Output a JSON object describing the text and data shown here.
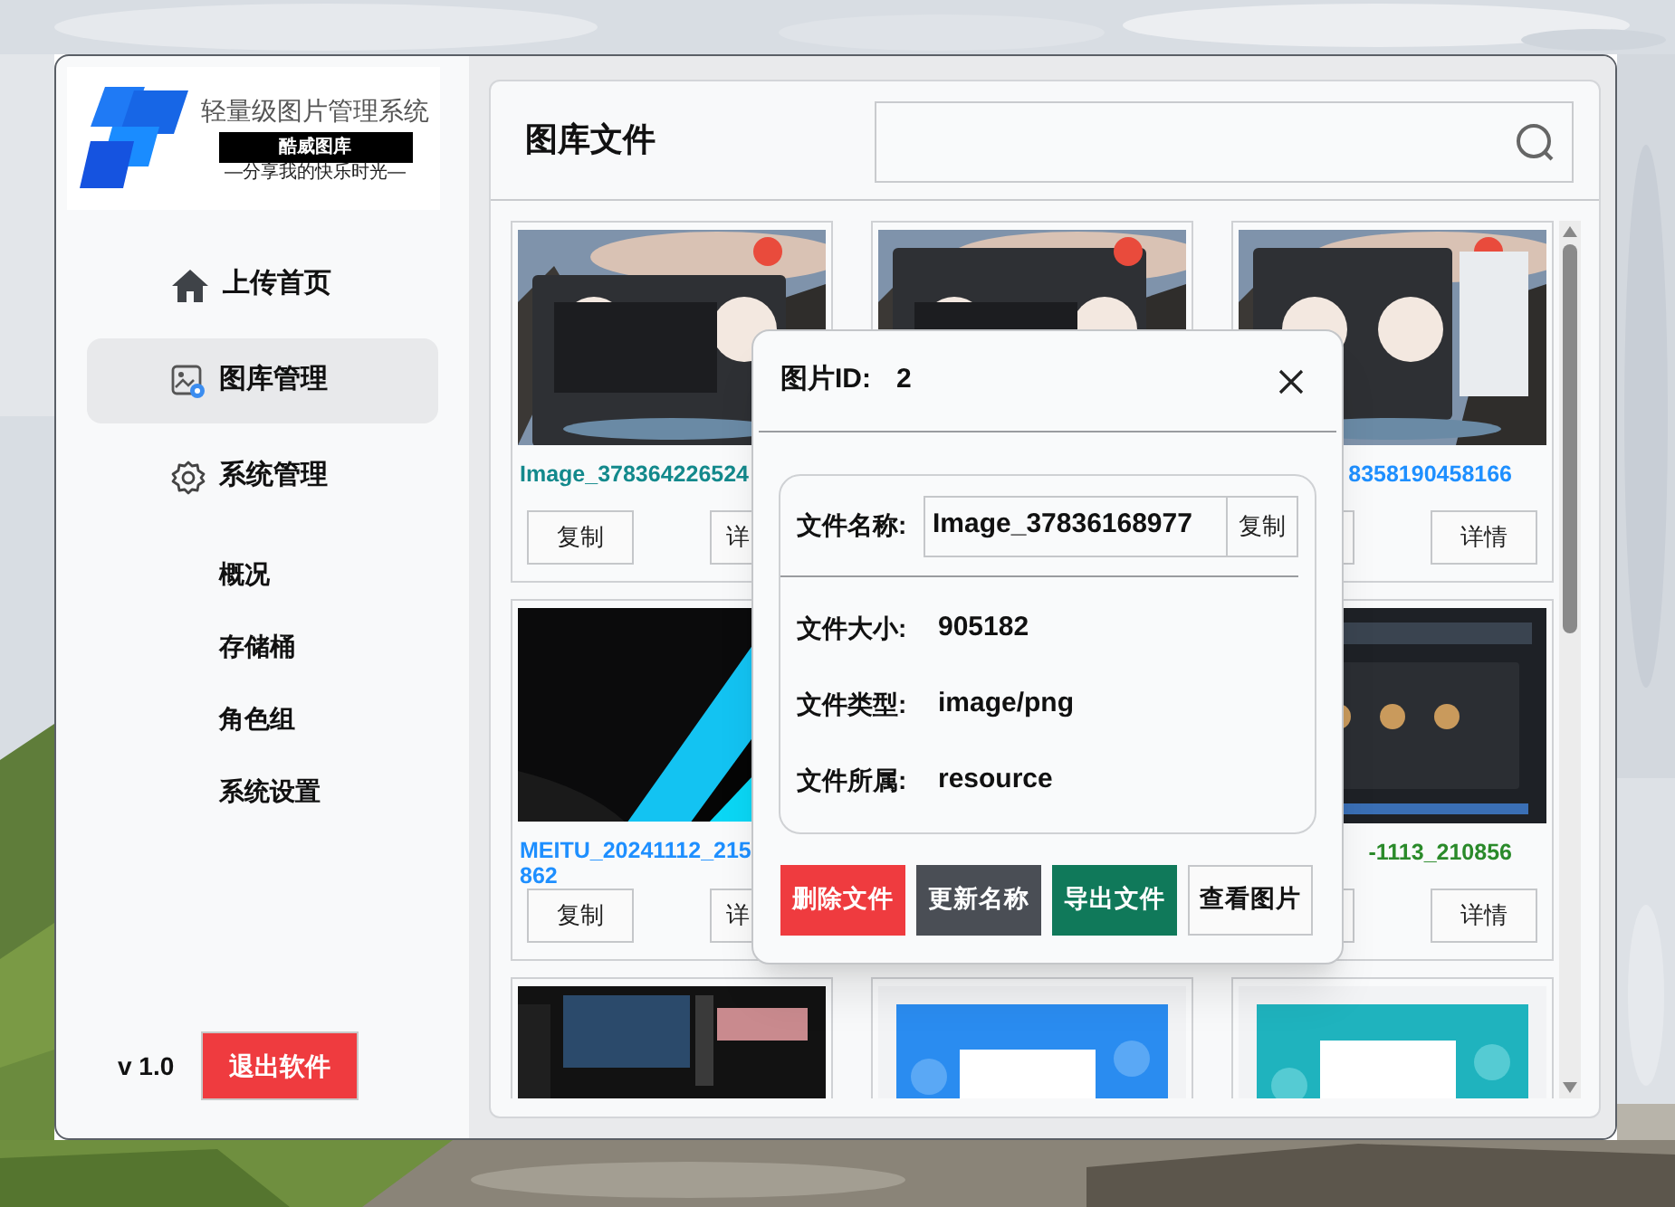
{
  "sidebar": {
    "logo": {
      "title": "轻量级图片管理系统",
      "banner": "酷威图库",
      "tagline": "—分享我的快乐时光—"
    },
    "nav": [
      {
        "label": "上传首页",
        "selected": false
      },
      {
        "label": "图库管理",
        "selected": true
      },
      {
        "label": "系统管理",
        "selected": false
      }
    ],
    "subnav": [
      "概况",
      "存储桶",
      "角色组",
      "系统设置"
    ],
    "version": "v 1.0",
    "exit_button": "退出软件"
  },
  "header": {
    "title": "图库文件"
  },
  "cards": [
    {
      "kind": "picture",
      "name": "Image_378364226524",
      "color": "#13898c",
      "buttons": [
        {
          "kind": "copy",
          "label": "复制"
        },
        {
          "kind": "details",
          "label": "详"
        }
      ]
    },
    {
      "kind": "picture"
    },
    {
      "kind": "picture",
      "name": "8358190458166",
      "color": "#1e8fff",
      "buttons": [
        {
          "kind": "copy"
        },
        {
          "kind": "details",
          "label": "详情"
        }
      ]
    },
    {
      "kind": "picture",
      "name": "MEITU_20241112_215\n862",
      "color": "#1e8fff",
      "buttons": [
        {
          "kind": "copy",
          "label": "复制"
        },
        {
          "kind": "details",
          "label": "详"
        }
      ]
    },
    {
      "kind": "covered"
    },
    {
      "kind": "picture",
      "name": "-1113_210856",
      "color": "#2a8a2a",
      "buttons": [
        {
          "kind": "copy"
        },
        {
          "kind": "details",
          "label": "详情"
        }
      ]
    },
    {
      "kind": "picture"
    },
    {
      "kind": "picture"
    },
    {
      "kind": "picture"
    }
  ],
  "dialog": {
    "title_label": "图片ID:",
    "title_value": "2",
    "fields": [
      {
        "kind": "input",
        "label": "文件名称:",
        "value": "Image_37836168977",
        "button": "复制"
      },
      {
        "kind": "text",
        "label": "文件大小:",
        "value": "905182"
      },
      {
        "kind": "text",
        "label": "文件类型:",
        "value": "image/png"
      },
      {
        "kind": "text",
        "label": "文件所属:",
        "value": "resource"
      }
    ],
    "buttons": [
      {
        "kind": "danger",
        "label": "删除文件"
      },
      {
        "kind": "secondary",
        "label": "更新名称"
      },
      {
        "kind": "success",
        "label": "导出文件"
      },
      {
        "kind": "outline",
        "label": "查看图片"
      }
    ]
  }
}
